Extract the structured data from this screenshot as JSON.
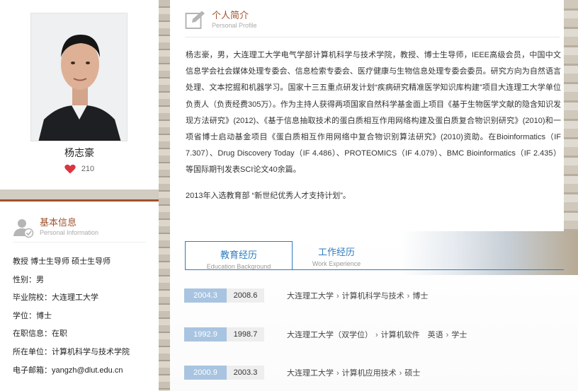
{
  "profile_card": {
    "name": "杨志豪",
    "likes": "210"
  },
  "basic_info": {
    "title": "基本信息",
    "subtitle": "Personal Information",
    "lines": [
      "教授 博士生导师 硕士生导师",
      "性别：男",
      "毕业院校：大连理工大学",
      "学位：博士",
      "在职信息：在职",
      "所在单位：计算机科学与技术学院",
      "电子邮箱：yangzh@dlut.edu.cn"
    ]
  },
  "personal_profile": {
    "title": "个人简介",
    "subtitle": "Personal Profile",
    "body": "杨志豪，男，大连理工大学电气学部计算机科学与技术学院，教授、博士生导师，IEEE高级会员，中国中文信息学会社会媒体处理专委会、信息检索专委会、医疗健康与生物信息处理专委会委员。研究方向为自然语言处理、文本挖掘和机器学习。国家十三五重点研发计划“疾病研究精准医学知识库构建”项目大连理工大学单位负责人（负责经费305万）。作为主持人获得两项国家自然科学基金面上项目《基于生物医学文献的隐含知识发现方法研究》(2012)、《基于信息抽取技术的蛋白质相互作用网络构建及蛋白质复合物识别研究》(2010)和一项省博士启动基金项目《蛋白质相互作用网络中复合物识别算法研究》(2010)资助。在Bioinformatics（IF 7.307）、Drug Discovery Today（IF 4.486）、PROTEOMICS（IF 4.079）、BMC Bioinformatics（IF 2.435）等国际期刊发表SCI论文40余篇。",
    "note": "2013年入选教育部 “新世纪优秀人才支持计划”。"
  },
  "experience": {
    "tabs": [
      {
        "label": "教育经历",
        "sub": "Education Background",
        "active": true
      },
      {
        "label": "工作经历",
        "sub": "Work Experience",
        "active": false
      }
    ],
    "education": [
      {
        "start": "2004.3",
        "end": "2008.6",
        "school": "大连理工大学",
        "major": "计算机科学与技术",
        "degree": "博士"
      },
      {
        "start": "1992.9",
        "end": "1998.7",
        "school": "大连理工大学（双学位）",
        "major": "计算机软件　英语",
        "degree": "学士"
      },
      {
        "start": "2000.9",
        "end": "2003.3",
        "school": "大连理工大学",
        "major": "计算机应用技术",
        "degree": "硕士"
      }
    ]
  },
  "icons": {
    "heart": "heart-icon",
    "edit": "edit-icon",
    "user": "user-check-icon",
    "chevron": "chevron-right-icon"
  },
  "colors": {
    "accent_brown": "#a0522d",
    "accent_blue": "#2f7bbf",
    "date_blue": "#a8c4e0",
    "heart_red": "#d9363e"
  }
}
